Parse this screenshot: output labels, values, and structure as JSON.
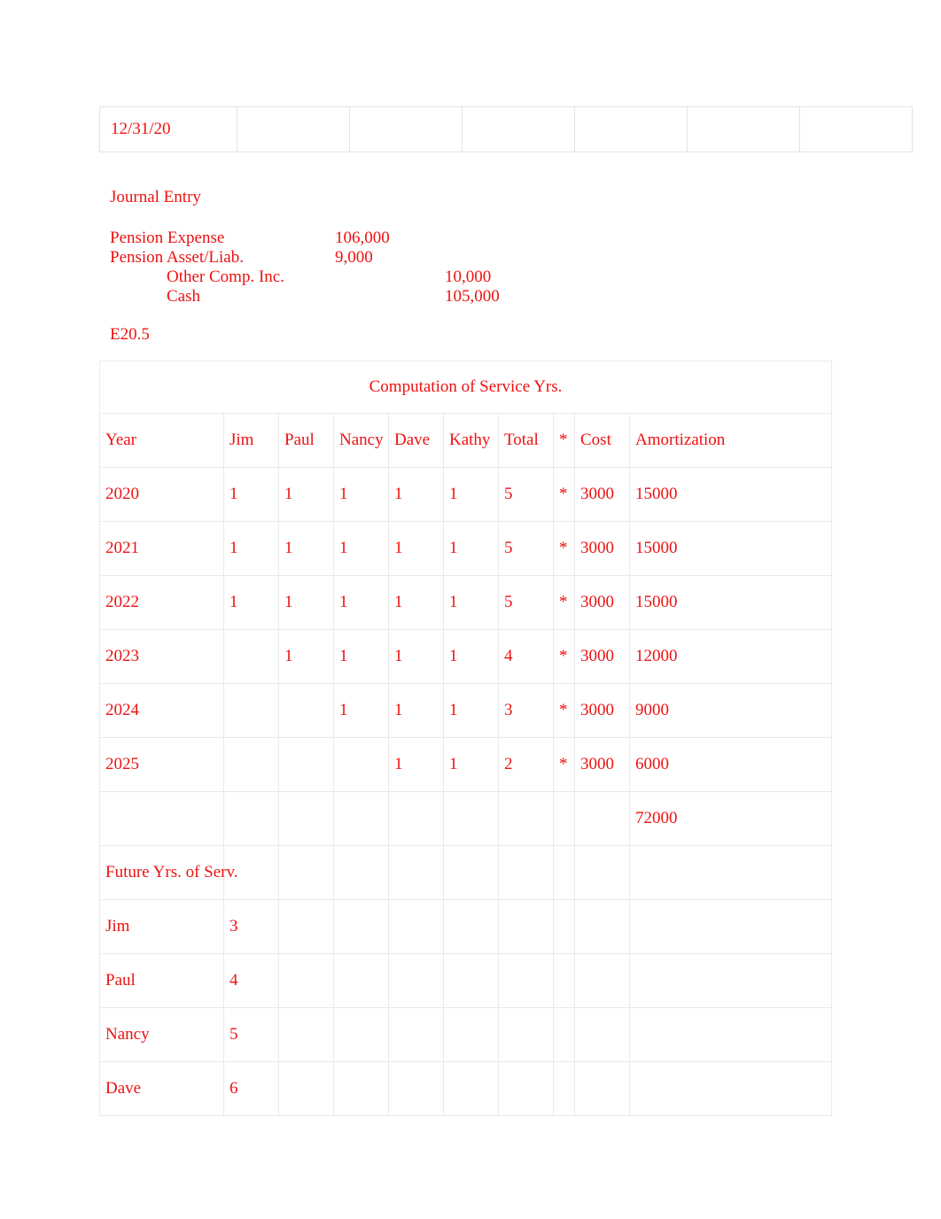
{
  "top_table": {
    "cells": [
      "12/31/20",
      "",
      "",
      "",
      "",
      "",
      ""
    ]
  },
  "journal": {
    "heading": "Journal Entry",
    "lines": [
      {
        "account": "Pension Expense",
        "indent": false,
        "debit": "106,000",
        "credit": ""
      },
      {
        "account": "Pension Asset/Liab.",
        "indent": false,
        "debit": "9,000",
        "credit": ""
      },
      {
        "account": "Other Comp. Inc.",
        "indent": true,
        "debit": "",
        "credit": "10,000"
      },
      {
        "account": "Cash",
        "indent": true,
        "debit": "",
        "credit": "105,000"
      }
    ]
  },
  "exercise_label": "E20.5",
  "main_table": {
    "title": "Computation of Service Yrs.",
    "headers": [
      "Year",
      "Jim",
      "Paul",
      "Nancy",
      "Dave",
      "Kathy",
      "Total",
      "*",
      "Cost",
      "Amortization"
    ],
    "rows": [
      [
        "2020",
        "1",
        "1",
        "1",
        "1",
        "1",
        "5",
        "*",
        "3000",
        "15000"
      ],
      [
        "2021",
        "1",
        "1",
        "1",
        "1",
        "1",
        "5",
        "*",
        "3000",
        "15000"
      ],
      [
        "2022",
        "1",
        "1",
        "1",
        "1",
        "1",
        "5",
        "*",
        "3000",
        "15000"
      ],
      [
        "2023",
        "",
        "1",
        "1",
        "1",
        "1",
        "4",
        "*",
        "3000",
        "12000"
      ],
      [
        "2024",
        "",
        "",
        "1",
        "1",
        "1",
        "3",
        "*",
        "3000",
        "9000"
      ],
      [
        "2025",
        "",
        "",
        "",
        "1",
        "1",
        "2",
        "*",
        "3000",
        "6000"
      ],
      [
        "",
        "",
        "",
        "",
        "",
        "",
        "",
        "",
        "",
        "72000"
      ],
      [
        "Future Yrs. of Serv.",
        "",
        "",
        "",
        "",
        "",
        "",
        "",
        "",
        ""
      ],
      [
        "Jim",
        "3",
        "",
        "",
        "",
        "",
        "",
        "",
        "",
        ""
      ],
      [
        "Paul",
        "4",
        "",
        "",
        "",
        "",
        "",
        "",
        "",
        ""
      ],
      [
        "Nancy",
        "5",
        "",
        "",
        "",
        "",
        "",
        "",
        "",
        ""
      ],
      [
        "Dave",
        "6",
        "",
        "",
        "",
        "",
        "",
        "",
        "",
        ""
      ]
    ]
  },
  "colors": {
    "text": "#ee1111",
    "grid": "#e9e9e9",
    "background": "#ffffff"
  }
}
